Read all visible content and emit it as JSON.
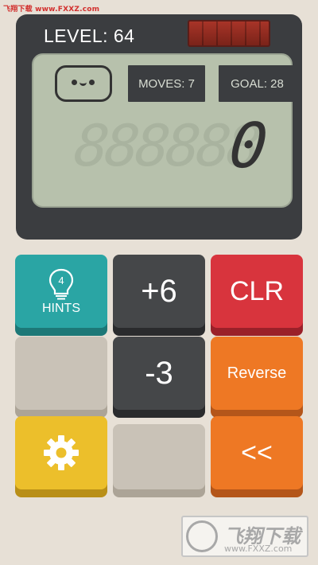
{
  "watermark_top": "飞翔下载 www.FXXZ.com",
  "level": {
    "text": "LEVEL: 64"
  },
  "screen": {
    "moves": "MOVES: 7",
    "goal": "GOAL: 28",
    "ghost_digits": "888888",
    "display_value": "0"
  },
  "buttons": {
    "hints_count": "4",
    "hints_label": "HINTS",
    "plus6": "+6",
    "clr": "CLR",
    "minus3": "-3",
    "reverse": "Reverse",
    "backspace": "<<"
  },
  "watermark_bottom": {
    "brand": "飞翔下载",
    "url": "www.FXXZ.com"
  },
  "colors": {
    "background": "#e7e0d6",
    "calculator_body": "#3b3d40",
    "lcd": "#b7c1ac",
    "teal": "#2aa5a4",
    "red": "#d8343d",
    "orange": "#ee7824",
    "yellow": "#ecbf2b",
    "gray": "#c9c2b7"
  },
  "icons": [
    "smiley-face-icon",
    "lightbulb-icon",
    "gear-icon",
    "solar-panel-icon"
  ]
}
